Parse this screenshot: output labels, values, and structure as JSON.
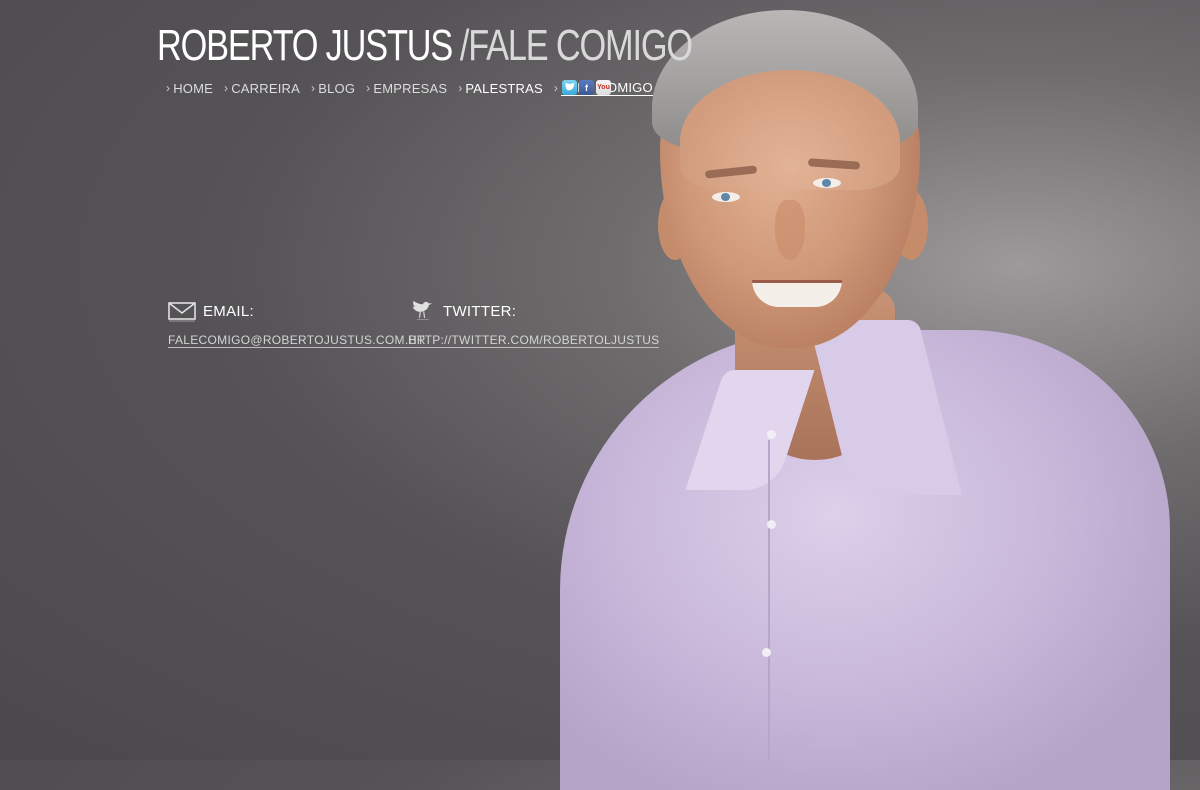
{
  "header": {
    "site_name": "ROBERTO JUSTUS",
    "section": "/FALE COMIGO"
  },
  "nav": {
    "items": [
      {
        "label": "HOME"
      },
      {
        "label": "CARREIRA"
      },
      {
        "label": "BLOG"
      },
      {
        "label": "EMPRESAS"
      },
      {
        "label": "PALESTRAS"
      },
      {
        "label": "FALE COMIGO",
        "active": true
      }
    ],
    "chevron": "›"
  },
  "social": {
    "icons": [
      "twitter-icon",
      "facebook-icon",
      "youtube-icon"
    ],
    "facebook_glyph": "f",
    "youtube_glyph": "You"
  },
  "contact": {
    "email": {
      "label": "EMAIL:",
      "icon": "envelope-icon",
      "value": "FALECOMIGO@ROBERTOJUSTUS.COM.BR"
    },
    "twitter": {
      "label": "TWITTER:",
      "icon": "bird-icon",
      "value": "HTTP://TWITTER.COM/ROBERTOLJUSTUS"
    }
  },
  "colors": {
    "background": "#555356",
    "text": "#e6e6e6",
    "shirt": "#c9b8da"
  }
}
